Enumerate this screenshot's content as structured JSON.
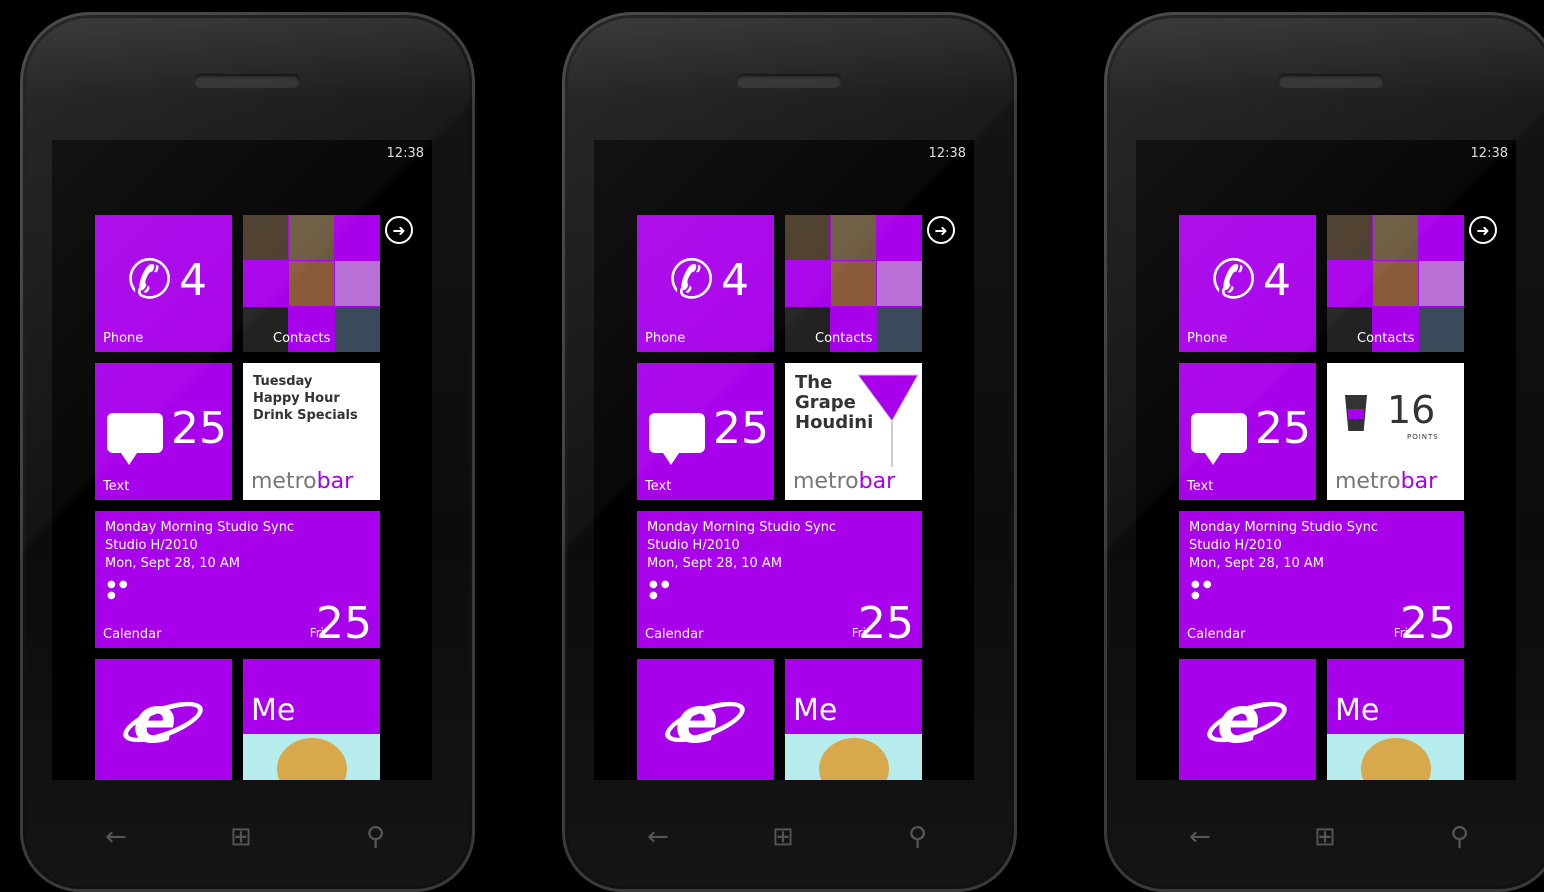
{
  "phones": [
    {
      "status": {
        "time": "12:38"
      },
      "tiles": {
        "phone": {
          "count": "4",
          "label": "Phone"
        },
        "people": {
          "label": "Contacts"
        },
        "text": {
          "count": "25",
          "label": "Text"
        },
        "metrobar": {
          "message_lines": [
            "Tuesday",
            "Happy Hour",
            "Drink Specials"
          ],
          "brand_a": "metro",
          "brand_b": "bar"
        },
        "calendar": {
          "line1": "Monday Morning Studio Sync",
          "line2": "Studio H/2010",
          "line3": "Mon, Sept 28, 10 AM",
          "label": "Calendar",
          "day": "Fri",
          "date": "25"
        },
        "ie": {
          "label": "Internet Explorer"
        },
        "me": {
          "label": "Me"
        }
      }
    },
    {
      "status": {
        "time": "12:38"
      },
      "tiles": {
        "phone": {
          "count": "4",
          "label": "Phone"
        },
        "people": {
          "label": "Contacts"
        },
        "text": {
          "count": "25",
          "label": "Text"
        },
        "metrobar": {
          "message_lines": [
            "The",
            "Grape",
            "Houdini"
          ],
          "brand_a": "metro",
          "brand_b": "bar"
        },
        "calendar": {
          "line1": "Monday Morning Studio Sync",
          "line2": "Studio H/2010",
          "line3": "Mon, Sept 28, 10 AM",
          "label": "Calendar",
          "day": "Fri",
          "date": "25"
        },
        "ie": {
          "label": "Internet Explorer"
        },
        "me": {
          "label": "Me"
        }
      }
    },
    {
      "status": {
        "time": "12:38"
      },
      "tiles": {
        "phone": {
          "count": "4",
          "label": "Phone"
        },
        "people": {
          "label": "Contacts"
        },
        "text": {
          "count": "25",
          "label": "Text"
        },
        "metrobar": {
          "points": "16",
          "points_label": "POINTS",
          "brand_a": "metro",
          "brand_b": "bar"
        },
        "calendar": {
          "line1": "Monday Morning Studio Sync",
          "line2": "Studio H/2010",
          "line3": "Mon, Sept 28, 10 AM",
          "label": "Calendar",
          "day": "Fri",
          "date": "25"
        },
        "ie": {
          "label": "Internet Explorer"
        },
        "me": {
          "label": "Me"
        }
      }
    }
  ],
  "colors": {
    "accent": "#a800ea",
    "tile_white": "#ffffff",
    "background": "#000000"
  }
}
